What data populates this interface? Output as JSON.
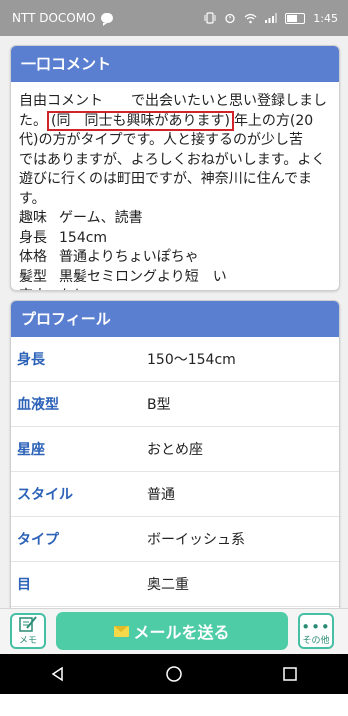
{
  "statusbar": {
    "carrier": "NTT DOCOMO",
    "time": "1:45"
  },
  "comment": {
    "header": "一口コメント",
    "line1": "自由コメント　　で出会いたいと思い登録しました。",
    "highlight": "(同　同士も興味があります)",
    "line2": "年上の方(20代)の方がタイプです。人と接するのが少し苦　ではありますが、よろしくおねがいします。よく遊びに行くのは町田ですが、神奈川に住んでます。",
    "attributes": [
      {
        "label": "趣味",
        "value": "ゲーム、読書"
      },
      {
        "label": "身長",
        "value": "154cm"
      },
      {
        "label": "体格",
        "value": "普通よりちょいぽちゃ"
      },
      {
        "label": "髪型",
        "value": "黒髪セミロングより短　い"
      },
      {
        "label": "恋人",
        "value": "なし"
      }
    ]
  },
  "profile": {
    "header": "プロフィール",
    "rows": [
      {
        "label": "身長",
        "value": "150〜154cm"
      },
      {
        "label": "血液型",
        "value": "B型"
      },
      {
        "label": "星座",
        "value": "おとめ座"
      },
      {
        "label": "スタイル",
        "value": "普通"
      },
      {
        "label": "タイプ",
        "value": "ボーイッシュ系"
      },
      {
        "label": "目",
        "value": "奥二重"
      }
    ]
  },
  "bottombar": {
    "memo_label": "メモ",
    "mail_label": "メールを送る",
    "more_label": "その他"
  },
  "colors": {
    "header_blue": "#5b7fd0",
    "accent_green": "#4ecca6",
    "label_blue": "#2c62b8",
    "highlight_red": "#d0232a"
  }
}
